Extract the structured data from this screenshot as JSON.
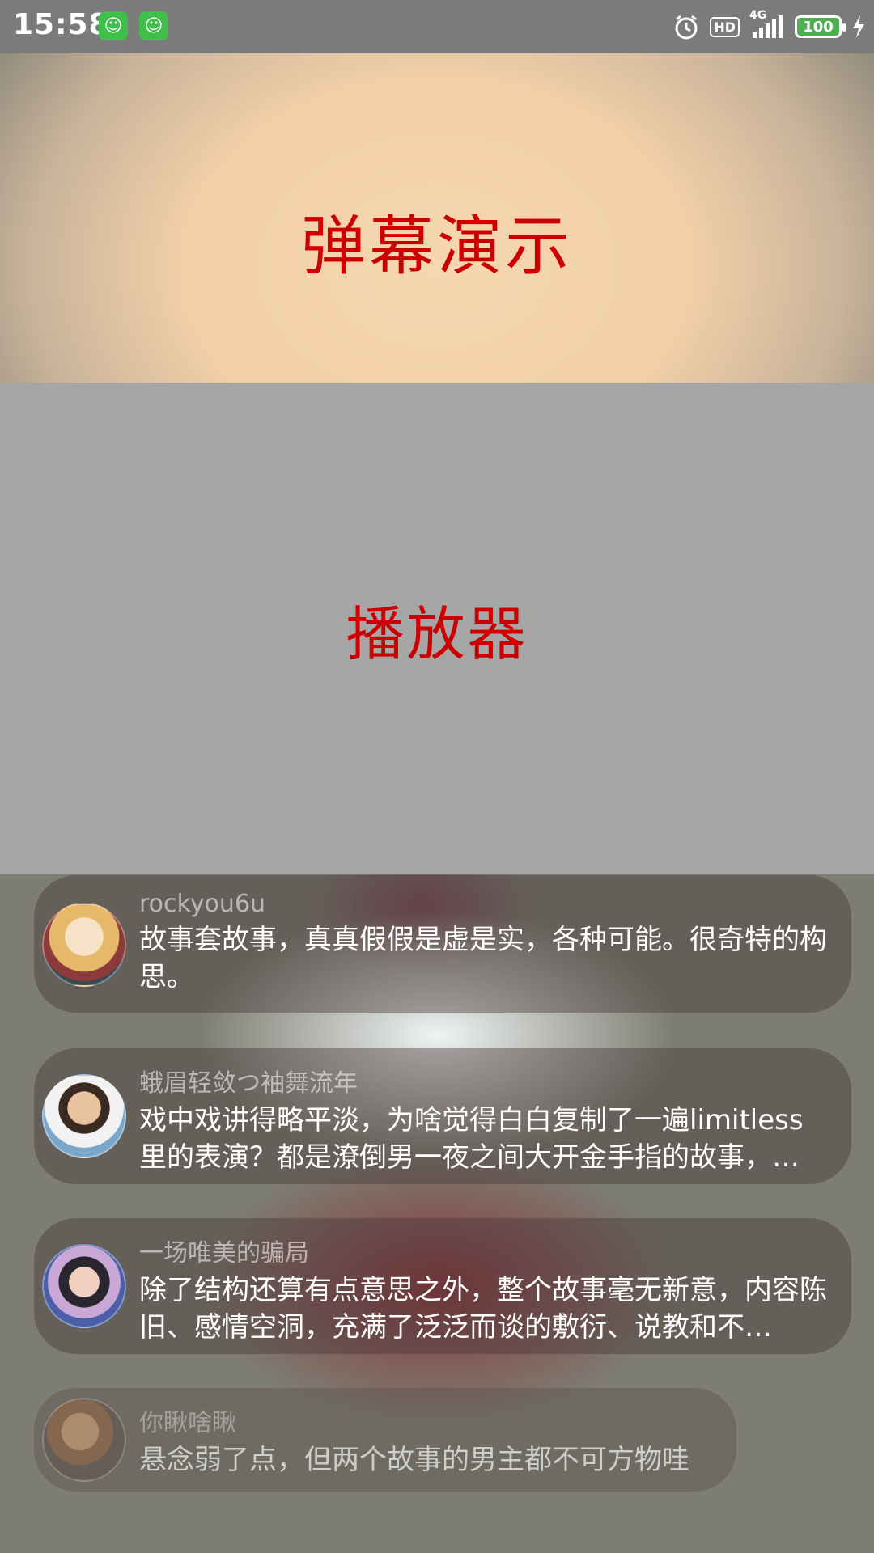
{
  "status_bar": {
    "time": "15:58",
    "notification_icons": [
      "app-icon",
      "app-icon"
    ],
    "hd_label": "HD",
    "network_label": "4G",
    "battery_level": "100"
  },
  "title": "弹幕演示",
  "player": {
    "label": "播放器"
  },
  "danmaku": [
    {
      "username": "rockyou6u",
      "text": "故事套故事，真真假假是虚是实，各种可能。很奇特的构思。"
    },
    {
      "username": "蛾眉轻敛つ袖舞流年",
      "text": "戏中戏讲得略平淡，为啥觉得白白复制了一遍limitless里的表演？都是潦倒男一夜之间大开金手指的故事，…"
    },
    {
      "username": "一场唯美的骗局",
      "text": "除了结构还算有点意思之外，整个故事毫无新意，内容陈旧、感情空洞，充满了泛泛而谈的敷衍、说教和不…"
    },
    {
      "username": "你瞅啥瞅",
      "text": "悬念弱了点，但两个故事的男主都不可方物哇"
    }
  ],
  "colors": {
    "title_color": "#cc0000",
    "player_bg": "#a6a6a6",
    "status_bar_bg": "#7b7b7b",
    "battery_color": "#4caf50",
    "app_icon_color": "#3fbf4a"
  }
}
